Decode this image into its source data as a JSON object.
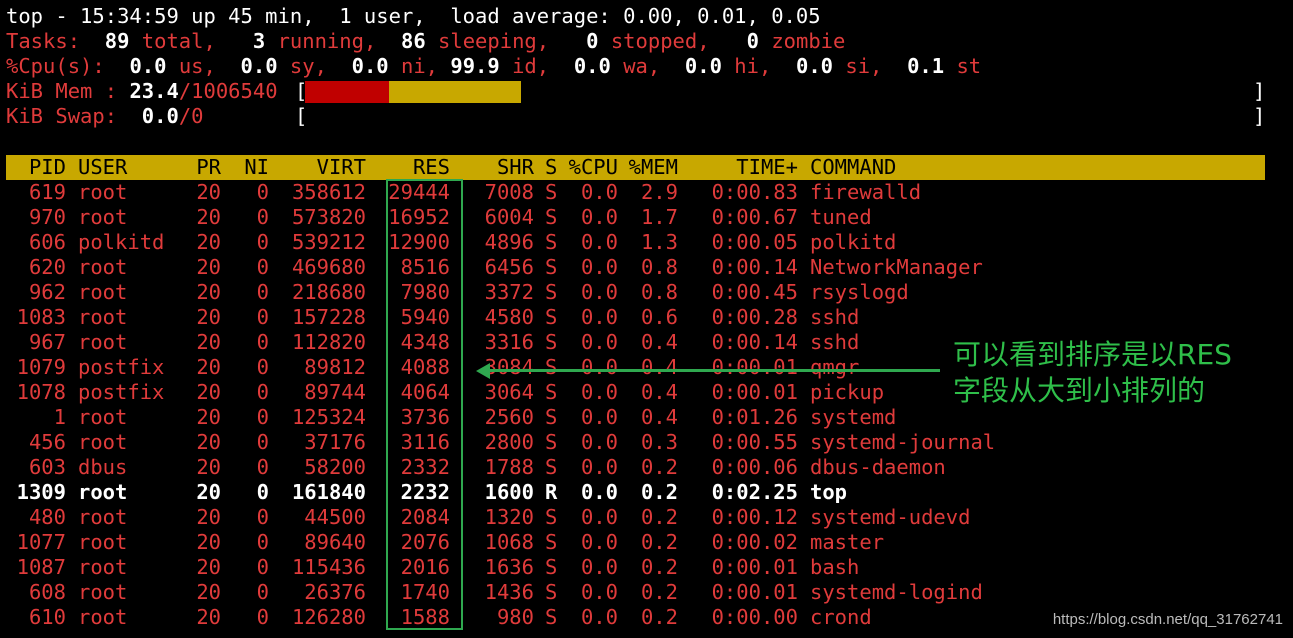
{
  "summary": {
    "line1": "top - 15:34:59 up 45 min,  1 user,  load average: 0.00, 0.01, 0.05",
    "tasks": {
      "label": "Tasks:",
      "total": "89",
      "total_label": "total,",
      "running": "3",
      "running_label": "running,",
      "sleeping": "86",
      "sleeping_label": "sleeping,",
      "stopped": "0",
      "stopped_label": "stopped,",
      "zombie": "0",
      "zombie_label": "zombie"
    },
    "cpu": {
      "label": "%Cpu(s):",
      "us": "0.0",
      "us_label": "us,",
      "sy": "0.0",
      "sy_label": "sy,",
      "ni": "0.0",
      "ni_label": "ni,",
      "id": "99.9",
      "id_label": "id,",
      "wa": "0.0",
      "wa_label": "wa,",
      "hi": "0.0",
      "hi_label": "hi,",
      "si": "0.0",
      "si_label": "si,",
      "st": "0.1",
      "st_label": "st"
    },
    "mem": {
      "label": "KiB Mem :",
      "used": "23.4",
      "total": "/1006540",
      "bar_left": "[",
      "bar_right": "]",
      "bar_red_fraction": 0.39,
      "bar_yellow_fraction": 0.61
    },
    "swap": {
      "label": "KiB Swap:",
      "used": "0.0",
      "total": "/0",
      "bar_left": "[",
      "bar_right": "]"
    }
  },
  "columns": [
    "PID",
    "USER",
    "PR",
    "NI",
    "VIRT",
    "RES",
    "SHR",
    "S",
    "%CPU",
    "%MEM",
    "TIME+",
    "COMMAND"
  ],
  "processes": [
    [
      "619",
      "root",
      "20",
      "0",
      "358612",
      "29444",
      "7008",
      "S",
      "0.0",
      "2.9",
      "0:00.83",
      "firewalld"
    ],
    [
      "970",
      "root",
      "20",
      "0",
      "573820",
      "16952",
      "6004",
      "S",
      "0.0",
      "1.7",
      "0:00.67",
      "tuned"
    ],
    [
      "606",
      "polkitd",
      "20",
      "0",
      "539212",
      "12900",
      "4896",
      "S",
      "0.0",
      "1.3",
      "0:00.05",
      "polkitd"
    ],
    [
      "620",
      "root",
      "20",
      "0",
      "469680",
      "8516",
      "6456",
      "S",
      "0.0",
      "0.8",
      "0:00.14",
      "NetworkManager"
    ],
    [
      "962",
      "root",
      "20",
      "0",
      "218680",
      "7980",
      "3372",
      "S",
      "0.0",
      "0.8",
      "0:00.45",
      "rsyslogd"
    ],
    [
      "1083",
      "root",
      "20",
      "0",
      "157228",
      "5940",
      "4580",
      "S",
      "0.0",
      "0.6",
      "0:00.28",
      "sshd"
    ],
    [
      "967",
      "root",
      "20",
      "0",
      "112820",
      "4348",
      "3316",
      "S",
      "0.0",
      "0.4",
      "0:00.14",
      "sshd"
    ],
    [
      "1079",
      "postfix",
      "20",
      "0",
      "89812",
      "4088",
      "3084",
      "S",
      "0.0",
      "0.4",
      "0:00.01",
      "qmgr"
    ],
    [
      "1078",
      "postfix",
      "20",
      "0",
      "89744",
      "4064",
      "3064",
      "S",
      "0.0",
      "0.4",
      "0:00.01",
      "pickup"
    ],
    [
      "1",
      "root",
      "20",
      "0",
      "125324",
      "3736",
      "2560",
      "S",
      "0.0",
      "0.4",
      "0:01.26",
      "systemd"
    ],
    [
      "456",
      "root",
      "20",
      "0",
      "37176",
      "3116",
      "2800",
      "S",
      "0.0",
      "0.3",
      "0:00.55",
      "systemd-journal"
    ],
    [
      "603",
      "dbus",
      "20",
      "0",
      "58200",
      "2332",
      "1788",
      "S",
      "0.0",
      "0.2",
      "0:00.06",
      "dbus-daemon"
    ],
    [
      "1309",
      "root",
      "20",
      "0",
      "161840",
      "2232",
      "1600",
      "R",
      "0.0",
      "0.2",
      "0:02.25",
      "top"
    ],
    [
      "480",
      "root",
      "20",
      "0",
      "44500",
      "2084",
      "1320",
      "S",
      "0.0",
      "0.2",
      "0:00.12",
      "systemd-udevd"
    ],
    [
      "1077",
      "root",
      "20",
      "0",
      "89640",
      "2076",
      "1068",
      "S",
      "0.0",
      "0.2",
      "0:00.02",
      "master"
    ],
    [
      "1087",
      "root",
      "20",
      "0",
      "115436",
      "2016",
      "1636",
      "S",
      "0.0",
      "0.2",
      "0:00.01",
      "bash"
    ],
    [
      "608",
      "root",
      "20",
      "0",
      "26376",
      "1740",
      "1436",
      "S",
      "0.0",
      "0.2",
      "0:00.01",
      "systemd-logind"
    ],
    [
      "610",
      "root",
      "20",
      "0",
      "126280",
      "1588",
      "980",
      "S",
      "0.0",
      "0.2",
      "0:00.00",
      "crond"
    ]
  ],
  "highlight_row": 12,
  "annotation": {
    "line1": "可以看到排序是以RES",
    "line2": "字段从大到小排列的"
  },
  "watermark": "https://blog.csdn.net/qq_31762741",
  "colors": {
    "background": "#000000",
    "red_text": "#e03b3b",
    "header_bar": "#c8a800",
    "mem_red": "#c00000",
    "annotation_green": "#2fbf4a"
  }
}
